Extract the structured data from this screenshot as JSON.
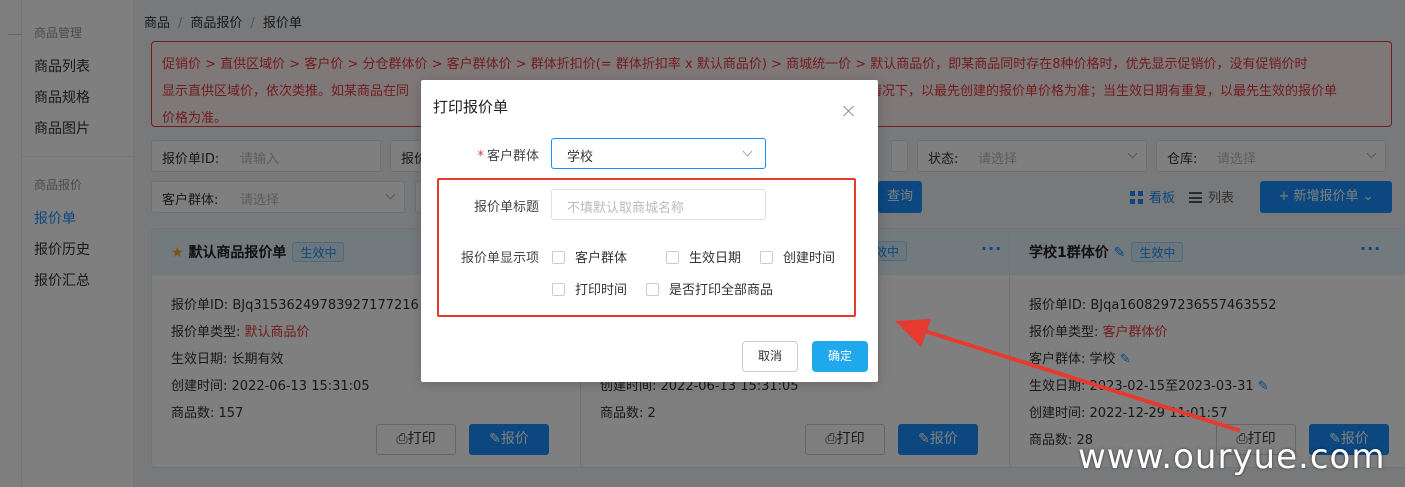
{
  "sidebar": {
    "group1": "商品管理",
    "items1": [
      "商品列表",
      "商品规格",
      "商品图片"
    ],
    "group2": "商品报价",
    "items2": [
      "报价单",
      "报价历史",
      "报价汇总"
    ]
  },
  "breadcrumb": [
    "商品",
    "商品报价",
    "报价单"
  ],
  "alert": {
    "line1": "促销价 > 直供区域价 > 客户价 > 分仓群体价 > 客户群体价 > 群体折扣价(= 群体折扣率 x 默认商品价) > 商城统一价 > 默认商品价，即某商品同时存在8种价格时，优先显示促销价，没有促销价时",
    "line2a": "显示直供区域价，依次类推。如某商品在同",
    "line2b": "情况下，以最先创建的报价单价格为准；当生效日期有重复，以最先生效的报价单",
    "line3": "价格为准。"
  },
  "filters": {
    "id_label": "报价单ID:",
    "id_placeholder": "请输入",
    "type_label_partial": "报价",
    "status_label": "状态:",
    "status_placeholder": "请选择",
    "warehouse_label": "仓库:",
    "warehouse_placeholder": "请选择",
    "group_label": "客户群体:",
    "group_placeholder": "请选择",
    "query_button_partial": "查询"
  },
  "toolbar": {
    "board_view": "看板",
    "list_view": "列表",
    "add_button": "+ 新增报价单"
  },
  "cards": [
    {
      "title": "默认商品报价单",
      "badge": "生效中",
      "id_label": "报价单ID:",
      "id_value": "BJq31536249783927177216",
      "type_label": "报价单类型:",
      "type_value": "默认商品价",
      "date_label": "生效日期:",
      "date_value": "长期有效",
      "created_label": "创建时间:",
      "created_value": "2022-06-13 15:31:05",
      "count_label": "商品数:",
      "count_value": "157",
      "print_button": "打印",
      "quote_button": "报价"
    },
    {
      "badge": "生效中",
      "created_partial": "创建时间:  2022-06-13 15:31:05",
      "count_label": "商品数:",
      "count_value": "2",
      "print_button": "打印",
      "quote_button": "报价"
    },
    {
      "title": "学校1群体价",
      "badge": "生效中",
      "id_label": "报价单ID:",
      "id_value": "BJqa1608297236557463552",
      "type_label": "报价单类型:",
      "type_value": "客户群体价",
      "group_label": "客户群体:",
      "group_value": "学校",
      "date_label": "生效日期:",
      "date_value": "2023-02-15至2023-03-31",
      "created_label": "创建时间:",
      "created_value": "2022-12-29 11:01:57",
      "count_label": "商品数:",
      "count_value": "28",
      "print_button": "打印",
      "quote_button": "报价"
    }
  ],
  "dialog": {
    "title": "打印报价单",
    "customer_group_label": "客户群体",
    "customer_group_value": "学校",
    "title_field_label": "报价单标题",
    "title_field_placeholder": "不填默认取商城名称",
    "display_items_label": "报价单显示项",
    "options": [
      "客户群体",
      "生效日期",
      "创建时间",
      "打印时间",
      "是否打印全部商品"
    ],
    "cancel": "取消",
    "confirm": "确定"
  },
  "watermark": "www.ouryue.com",
  "colors": {
    "accent": "#1890ff",
    "danger": "#e4393c",
    "annotation": "#e53a2f"
  }
}
